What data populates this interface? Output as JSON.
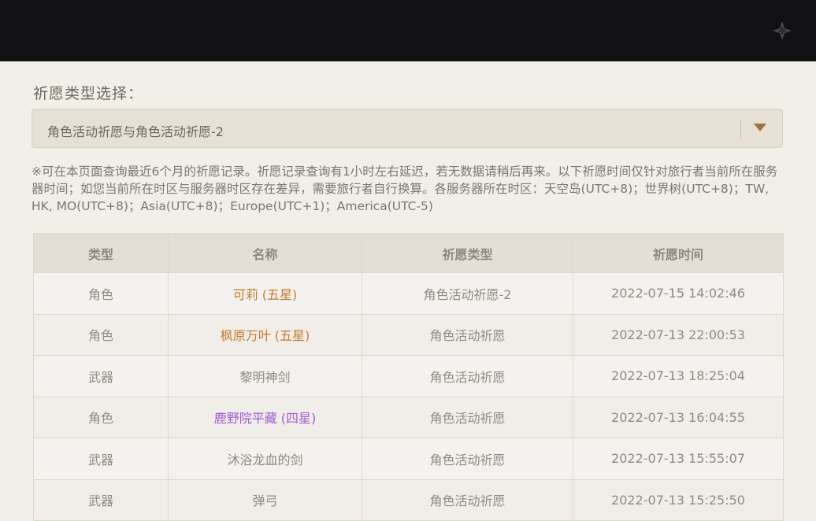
{
  "header": {
    "logo_icon": "paimon-star-icon"
  },
  "filter": {
    "label": "祈愿类型选择：",
    "selected": "角色活动祈愿与角色活动祈愿-2",
    "arrow_icon": "chevron-down-icon",
    "accent_color": "#a0743f"
  },
  "notice": "※可在本页面查询最近6个月的祈愿记录。祈愿记录查询有1小时左右延迟，若无数据请稍后再来。以下祈愿时间仅针对旅行者当前所在服务器时间；如您当前所在时区与服务器时区存在差异，需要旅行者自行换算。各服务器所在时区：天空岛(UTC+8)；世界树(UTC+8)；TW, HK, MO(UTC+8)；Asia(UTC+8)；Europe(UTC+1)；America(UTC-5)",
  "table": {
    "headers": [
      "类型",
      "名称",
      "祈愿类型",
      "祈愿时间"
    ],
    "rows": [
      {
        "type": "角色",
        "name": "可莉 (五星)",
        "pool": "角色活动祈愿-2",
        "time": "2022-07-15 14:02:46",
        "rarity": "five"
      },
      {
        "type": "角色",
        "name": "枫原万叶 (五星)",
        "pool": "角色活动祈愿",
        "time": "2022-07-13 22:00:53",
        "rarity": "five"
      },
      {
        "type": "武器",
        "name": "黎明神剑",
        "pool": "角色活动祈愿",
        "time": "2022-07-13 18:25:04",
        "rarity": "three"
      },
      {
        "type": "角色",
        "name": "鹿野院平藏 (四星)",
        "pool": "角色活动祈愿",
        "time": "2022-07-13 16:04:55",
        "rarity": "four"
      },
      {
        "type": "武器",
        "name": "沐浴龙血的剑",
        "pool": "角色活动祈愿",
        "time": "2022-07-13 15:55:07",
        "rarity": "three"
      },
      {
        "type": "武器",
        "name": "弹弓",
        "pool": "角色活动祈愿",
        "time": "2022-07-13 15:25:50",
        "rarity": "three"
      }
    ],
    "colors": {
      "five_star": "#c67a2e",
      "four_star": "#a35bd6"
    }
  }
}
